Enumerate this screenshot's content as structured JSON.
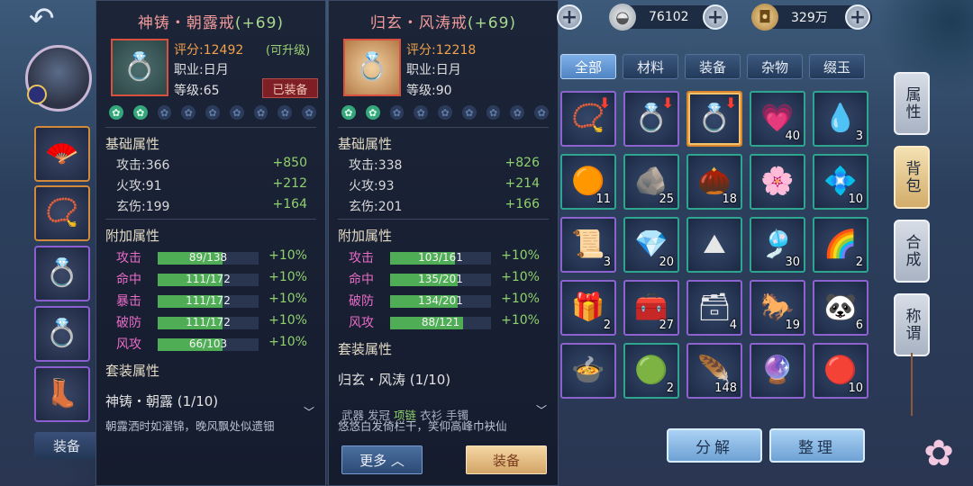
{
  "top_bar": {
    "silver_amount": "76102",
    "coin_amount": "329万"
  },
  "left": {
    "equip_tab_label": "装备"
  },
  "panel_current": {
    "title": "神铸・朝露戒",
    "plus": "(+69)",
    "score": "评分:12492",
    "upgradable": "(可升级)",
    "profession": "职业:日月",
    "level": "等级:65",
    "equipped_badge": "已装备",
    "gems_on": 2,
    "gems_total": 9,
    "base_title": "基础属性",
    "base_stats": [
      {
        "name": "攻击:366",
        "bonus": "+850"
      },
      {
        "name": "火攻:91",
        "bonus": "+212"
      },
      {
        "name": "玄伤:199",
        "bonus": "+164"
      }
    ],
    "extra_title": "附加属性",
    "extra_stats": [
      {
        "name": "攻击",
        "value": "89/138",
        "ratio": 0.645,
        "pct": "+10%"
      },
      {
        "name": "命中",
        "value": "111/172",
        "ratio": 0.645,
        "pct": "+10%"
      },
      {
        "name": "暴击",
        "value": "111/172",
        "ratio": 0.645,
        "pct": "+10%"
      },
      {
        "name": "破防",
        "value": "111/172",
        "ratio": 0.645,
        "pct": "+10%"
      },
      {
        "name": "风攻",
        "value": "66/103",
        "ratio": 0.64,
        "pct": "+10%"
      }
    ],
    "set_title": "套装属性",
    "set_name": "神铸・朝露 (1/10)",
    "description": "朝露洒时如濯锦，晚风飘处似遗钿"
  },
  "panel_new": {
    "title": "归玄・风涛戒",
    "plus": "(+69)",
    "score": "评分:12218",
    "profession": "职业:日月",
    "level": "等级:90",
    "gems_on": 2,
    "gems_total": 9,
    "base_title": "基础属性",
    "base_stats": [
      {
        "name": "攻击:338",
        "bonus": "+826"
      },
      {
        "name": "火攻:93",
        "bonus": "+214"
      },
      {
        "name": "玄伤:201",
        "bonus": "+166"
      }
    ],
    "extra_title": "附加属性",
    "extra_stats": [
      {
        "name": "攻击",
        "value": "103/161",
        "ratio": 0.64,
        "pct": "+10%"
      },
      {
        "name": "命中",
        "value": "135/201",
        "ratio": 0.672,
        "pct": "+10%"
      },
      {
        "name": "破防",
        "value": "134/201",
        "ratio": 0.667,
        "pct": "+10%"
      },
      {
        "name": "风攻",
        "value": "88/121",
        "ratio": 0.727,
        "pct": "+10%"
      }
    ],
    "set_title": "套装属性",
    "set_name": "归玄・风涛 (1/10)",
    "set_parts": [
      "武器",
      "发冠",
      "项链",
      "衣衫",
      "手镯"
    ],
    "description": "悠悠白发倚栏干，笑仰高峰巾袂仙",
    "more_label": "更多",
    "equip_label": "装备"
  },
  "bag": {
    "tabs": [
      "全部",
      "材料",
      "装备",
      "杂物",
      "缀玉"
    ],
    "active_tab": 0,
    "slots": [
      {
        "icon": "necklace-icon",
        "glyph": "📿",
        "count": "",
        "arrow": true,
        "border": "purple"
      },
      {
        "icon": "ring-red-icon",
        "glyph": "💍",
        "count": "",
        "arrow": true,
        "border": "purple"
      },
      {
        "icon": "ring-gold-icon",
        "glyph": "💍",
        "count": "",
        "arrow": true,
        "border": "orange"
      },
      {
        "icon": "heart-gem-icon",
        "glyph": "💗",
        "count": "40",
        "arrow": false,
        "border": "teal"
      },
      {
        "icon": "teardrop-crystal-icon",
        "glyph": "💧",
        "count": "3",
        "arrow": false,
        "border": "teal"
      },
      {
        "icon": "orange-orb-icon",
        "glyph": "🟠",
        "count": "11",
        "arrow": false,
        "border": "teal"
      },
      {
        "icon": "ore-icon",
        "glyph": "🪨",
        "count": "25",
        "arrow": false,
        "border": "teal"
      },
      {
        "icon": "lotus-seed-icon",
        "glyph": "🌰",
        "count": "18",
        "arrow": false,
        "border": "teal"
      },
      {
        "icon": "purple-flower-icon",
        "glyph": "🌸",
        "count": "",
        "arrow": false,
        "border": "teal"
      },
      {
        "icon": "blue-flower-icon",
        "glyph": "💠",
        "count": "10",
        "arrow": false,
        "border": "teal"
      },
      {
        "icon": "scroll-icon",
        "glyph": "📜",
        "count": "3",
        "arrow": false,
        "border": "purple"
      },
      {
        "icon": "crystal-shards-icon",
        "glyph": "💎",
        "count": "20",
        "arrow": false,
        "border": "teal"
      },
      {
        "icon": "sand-pile-icon",
        "glyph": "⛰",
        "count": "",
        "arrow": false,
        "border": "teal"
      },
      {
        "icon": "knot-charm-icon",
        "glyph": "🎐",
        "count": "30",
        "arrow": false,
        "border": "teal"
      },
      {
        "icon": "rainbow-gem-icon",
        "glyph": "🌈",
        "count": "2",
        "arrow": false,
        "border": "teal"
      },
      {
        "icon": "gem-box-icon",
        "glyph": "🎁",
        "count": "2",
        "arrow": false,
        "border": "purple"
      },
      {
        "icon": "chest-open-icon",
        "glyph": "🧰",
        "count": "27",
        "arrow": false,
        "border": "purple"
      },
      {
        "icon": "powder-box-icon",
        "glyph": "🗃",
        "count": "4",
        "arrow": false,
        "border": "purple"
      },
      {
        "icon": "saddle-icon",
        "glyph": "🐎",
        "count": "19",
        "arrow": false,
        "border": "purple"
      },
      {
        "icon": "panda-icon",
        "glyph": "🐼",
        "count": "6",
        "arrow": false,
        "border": "purple"
      },
      {
        "icon": "dish-icon",
        "glyph": "🍲",
        "count": "",
        "arrow": false,
        "border": "purple"
      },
      {
        "icon": "jade-coin-icon",
        "glyph": "🟢",
        "count": "2",
        "arrow": false,
        "border": "teal"
      },
      {
        "icon": "feather-icon",
        "glyph": "🪶",
        "count": "148",
        "arrow": false,
        "border": "purple"
      },
      {
        "icon": "crystal-ball-icon",
        "glyph": "🔮",
        "count": "",
        "arrow": false,
        "border": "purple"
      },
      {
        "icon": "fire-orb-icon",
        "glyph": "🔴",
        "count": "10",
        "arrow": false,
        "border": "purple"
      }
    ],
    "decompose_label": "分解",
    "sort_label": "整理"
  },
  "side_tabs": [
    {
      "label": "属性",
      "active": false
    },
    {
      "label": "背包",
      "active": true
    },
    {
      "label": "合成",
      "active": false
    },
    {
      "label": "称谓",
      "active": false
    }
  ],
  "left_equips": [
    {
      "icon": "fan-weapon-icon",
      "glyph": "🪭",
      "border": "orange"
    },
    {
      "icon": "necklace-icon",
      "glyph": "📿",
      "border": "orange"
    },
    {
      "icon": "ring-red-icon",
      "glyph": "💍",
      "border": "purple"
    },
    {
      "icon": "ring-teal-icon",
      "glyph": "💍",
      "border": "purple"
    },
    {
      "icon": "boots-icon",
      "glyph": "👢",
      "border": "purple"
    }
  ]
}
